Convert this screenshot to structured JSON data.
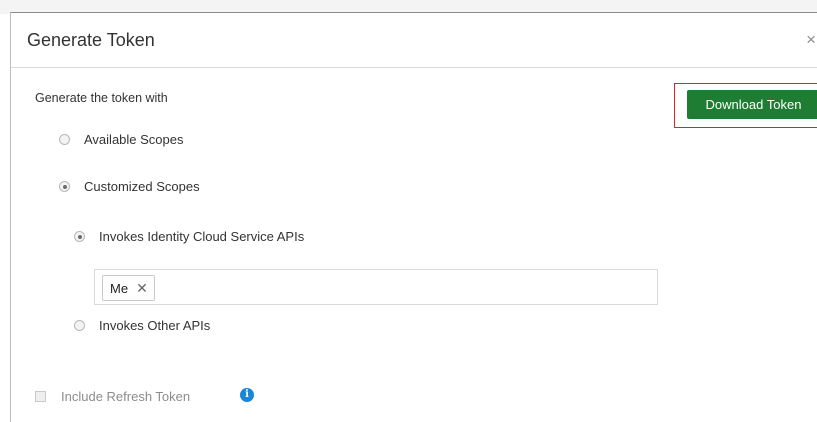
{
  "dialog": {
    "title": "Generate Token",
    "close_glyph": "×",
    "lead_text": "Generate the token with",
    "download_button": {
      "label": "Download Token",
      "color": "#1e7d32",
      "highlight_color": "#e2221f"
    },
    "scope_options": {
      "available": {
        "label": "Available Scopes",
        "selected": false
      },
      "customized": {
        "label": "Customized Scopes",
        "selected": true
      }
    },
    "api_options": {
      "identity_cloud": {
        "label": "Invokes Identity Cloud Service APIs",
        "selected": true
      },
      "other": {
        "label": "Invokes Other APIs",
        "selected": false
      }
    },
    "scope_tags": [
      {
        "label": "Me",
        "remove_glyph": "✕"
      }
    ],
    "refresh_token": {
      "label": "Include Refresh Token",
      "checked": false,
      "enabled": false,
      "info_icon": "info-icon",
      "info_glyph": "i"
    }
  }
}
